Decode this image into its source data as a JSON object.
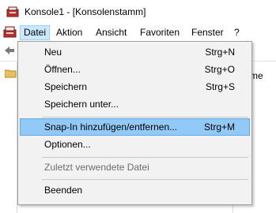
{
  "window": {
    "title": "Konsole1 - [Konsolenstamm]"
  },
  "menubar": {
    "items": [
      "Datei",
      "Aktion",
      "Ansicht",
      "Favoriten",
      "Fenster",
      "?"
    ]
  },
  "file_menu": {
    "items": [
      {
        "label": "Neu",
        "accel": "Strg+N"
      },
      {
        "label": "Öffnen...",
        "accel": "Strg+O"
      },
      {
        "label": "Speichern",
        "accel": "Strg+S"
      },
      {
        "label": "Speichern unter...",
        "accel": ""
      },
      {
        "label": "Snap-In hinzufügen/entfernen...",
        "accel": "Strg+M"
      },
      {
        "label": "Optionen...",
        "accel": ""
      },
      {
        "label": "Zuletzt verwendete Datei",
        "accel": ""
      },
      {
        "label": "Beenden",
        "accel": ""
      }
    ]
  },
  "list": {
    "column_partial": "me"
  },
  "colors": {
    "highlight": "#91c9f7",
    "menu_active": "#cce8ff",
    "menu_bg": "#f2f2f2"
  },
  "icons": [
    "mmc-app-icon",
    "mmc-menu-icon",
    "back-arrow-icon",
    "folder-icon"
  ]
}
